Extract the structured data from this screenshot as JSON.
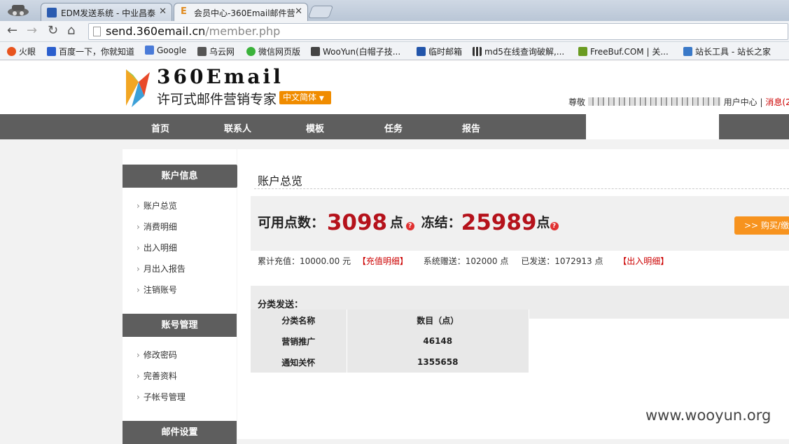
{
  "browser": {
    "tabs": [
      {
        "title": "EDM发送系统 - 中业昌泰"
      },
      {
        "title": "会员中心-360Email邮件营"
      }
    ],
    "url_host": "send.360email.cn",
    "url_path": "/member.php",
    "bookmarks": [
      {
        "label": "火眼",
        "color": "#e8541e"
      },
      {
        "label": "百度一下，你就知道",
        "color": "#2b5fce"
      },
      {
        "label": "Google",
        "color": "#4a7bd8"
      },
      {
        "label": "乌云网",
        "color": "#555555"
      },
      {
        "label": "微信网页版",
        "color": "#3bb23b"
      },
      {
        "label": "WooYun(白帽子技...",
        "color": "#444444"
      },
      {
        "label": "临时邮箱",
        "color": "#2255aa"
      },
      {
        "label": "md5在线查询破解,...",
        "color": "#333333"
      },
      {
        "label": "FreeBuf.COM | 关...",
        "color": "#6a9b21"
      },
      {
        "label": "站长工具 - 站长之家",
        "color": "#3a79c8"
      }
    ]
  },
  "header": {
    "brand": "360Email",
    "slogan": "许可式邮件营销专家",
    "language": "中文简体",
    "greeting": "尊敬",
    "user_center": "用户中心",
    "sep": "|",
    "messages": "消息(2"
  },
  "nav": [
    "首页",
    "联系人",
    "模板",
    "任务",
    "报告"
  ],
  "sidebar": {
    "account_info": "账户信息",
    "account_items": [
      "账户总览",
      "消费明细",
      "出入明细",
      "月出入报告",
      "注销账号"
    ],
    "account_mgmt": "账号管理",
    "mgmt_items": [
      "修改密码",
      "完善资料",
      "子帐号管理"
    ],
    "mail_settings": "邮件设置"
  },
  "main": {
    "title": "账户总览",
    "available_label": "可用点数：",
    "available_value": "3098",
    "unit1": "点",
    "frozen_label": "冻结：",
    "frozen_value": "25989",
    "unit2": "点",
    "buy_button": ">> 购买/缴费",
    "recharge_total": "累计充值：10000.00 元",
    "recharge_detail": "【充值明细】",
    "system_gift": "系统赠送：102000 点",
    "sent": "已发送：1072913 点",
    "io_detail": "【出入明细】",
    "category_title": "分类发送：",
    "table_headers": [
      "分类名称",
      "数目（点）"
    ],
    "table_rows": [
      [
        "营销推广",
        "46148"
      ],
      [
        "通知关怀",
        "1355658"
      ]
    ]
  },
  "watermark": "www.wooyun.org"
}
